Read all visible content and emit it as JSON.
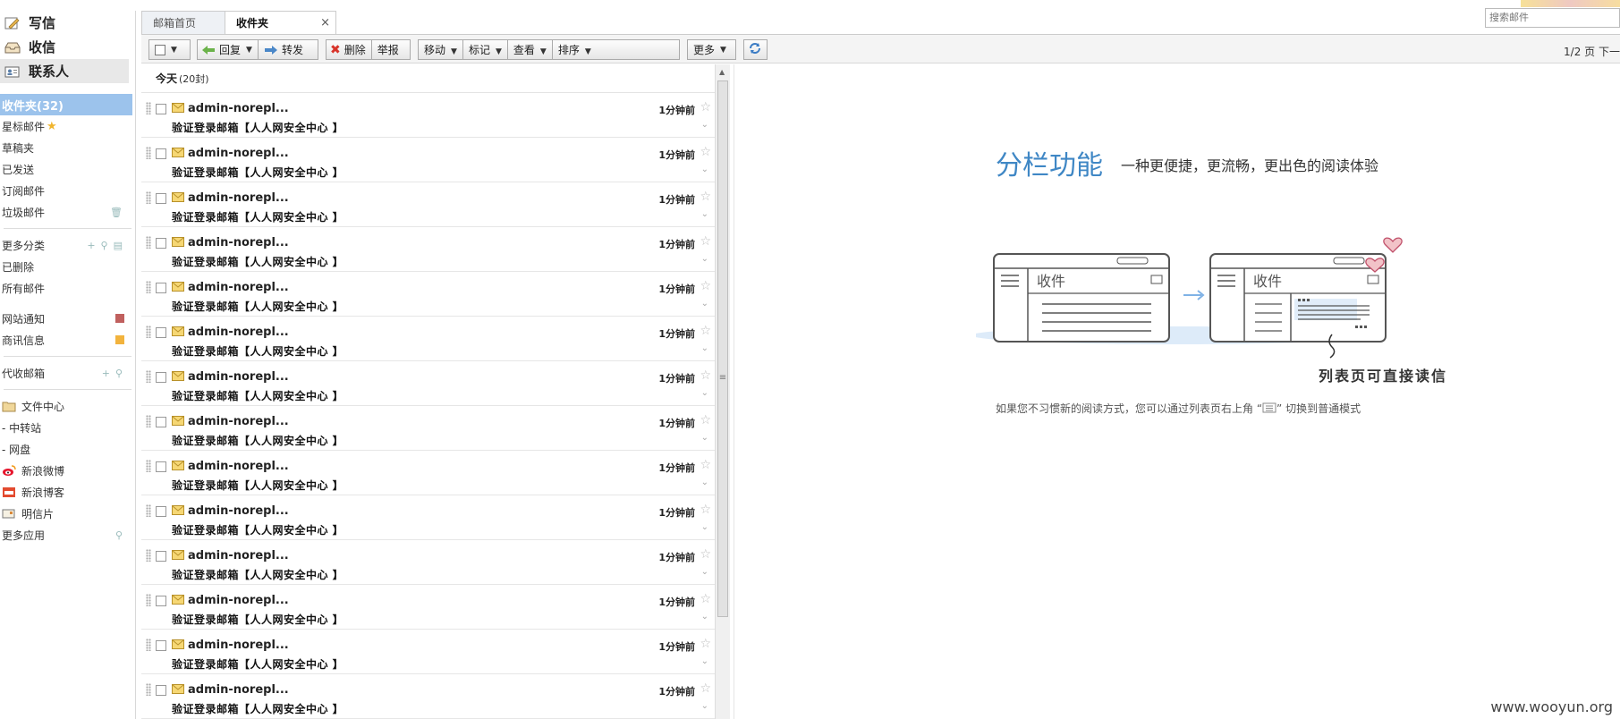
{
  "sidebar": {
    "actions": [
      {
        "label": "写信",
        "icon": "compose-icon"
      },
      {
        "label": "收信",
        "icon": "inbox-tray-icon"
      },
      {
        "label": "联系人",
        "icon": "contacts-card-icon"
      }
    ],
    "folders": [
      {
        "label": "收件夹(32)"
      },
      {
        "label": "星标邮件"
      },
      {
        "label": "草稿夹"
      },
      {
        "label": "已发送"
      },
      {
        "label": "订阅邮件"
      },
      {
        "label": "垃圾邮件"
      }
    ],
    "more_categories": "更多分类",
    "more_items": [
      "已删除",
      "所有邮件"
    ],
    "tag_items": [
      {
        "label": "网站通知",
        "color": "#c0605e"
      },
      {
        "label": "商讯信息",
        "color": "#f2b33d"
      }
    ],
    "proxy_mail": "代收邮箱",
    "apps": [
      {
        "label": "文件中心",
        "icon": "folder-icon"
      },
      {
        "label": "- 中转站"
      },
      {
        "label": "- 网盘"
      },
      {
        "label": "新浪微博",
        "icon": "weibo-icon"
      },
      {
        "label": "新浪博客",
        "icon": "blog-icon"
      },
      {
        "label": "明信片",
        "icon": "postcard-icon"
      }
    ],
    "more_apps": "更多应用"
  },
  "tabs": [
    {
      "label": "邮箱首页"
    },
    {
      "label": "收件夹",
      "close": "×"
    }
  ],
  "search": {
    "placeholder": "搜索邮件"
  },
  "toolbar": {
    "reply": "回复",
    "forward": "转发",
    "delete": "删除",
    "report": "举报",
    "move": "移动",
    "mark": "标记",
    "view": "查看",
    "sort": "排序",
    "more": "更多",
    "pager": "1/2 页  下一"
  },
  "list": {
    "group_title": "今天",
    "group_count": "(20封)",
    "rows": [
      {
        "sender": "admin-norepl...",
        "subject": "验证登录邮箱【人人网安全中心 】",
        "time": "1分钟前"
      },
      {
        "sender": "admin-norepl...",
        "subject": "验证登录邮箱【人人网安全中心 】",
        "time": "1分钟前"
      },
      {
        "sender": "admin-norepl...",
        "subject": "验证登录邮箱【人人网安全中心 】",
        "time": "1分钟前"
      },
      {
        "sender": "admin-norepl...",
        "subject": "验证登录邮箱【人人网安全中心 】",
        "time": "1分钟前"
      },
      {
        "sender": "admin-norepl...",
        "subject": "验证登录邮箱【人人网安全中心 】",
        "time": "1分钟前"
      },
      {
        "sender": "admin-norepl...",
        "subject": "验证登录邮箱【人人网安全中心 】",
        "time": "1分钟前"
      },
      {
        "sender": "admin-norepl...",
        "subject": "验证登录邮箱【人人网安全中心 】",
        "time": "1分钟前"
      },
      {
        "sender": "admin-norepl...",
        "subject": "验证登录邮箱【人人网安全中心 】",
        "time": "1分钟前"
      },
      {
        "sender": "admin-norepl...",
        "subject": "验证登录邮箱【人人网安全中心 】",
        "time": "1分钟前"
      },
      {
        "sender": "admin-norepl...",
        "subject": "验证登录邮箱【人人网安全中心 】",
        "time": "1分钟前"
      },
      {
        "sender": "admin-norepl...",
        "subject": "验证登录邮箱【人人网安全中心 】",
        "time": "1分钟前"
      },
      {
        "sender": "admin-norepl...",
        "subject": "验证登录邮箱【人人网安全中心 】",
        "time": "1分钟前"
      },
      {
        "sender": "admin-norepl...",
        "subject": "验证登录邮箱【人人网安全中心 】",
        "time": "1分钟前"
      },
      {
        "sender": "admin-norepl...",
        "subject": "验证登录邮箱【人人网安全中心 】",
        "time": "1分钟前"
      }
    ]
  },
  "preview": {
    "title": "分栏功能",
    "subtitle": "一种更便捷，更流畅，更出色的阅读体验",
    "illus_label_left": "收件",
    "illus_label_right": "收件",
    "caption": "列表页可直接读信",
    "tip_before": "如果您不习惯新的阅读方式，您可以通过列表页右上角 “",
    "tip_after": "” 切换到普通模式"
  },
  "watermark": "www.wooyun.org",
  "colors": {
    "accent": "#3f87c5",
    "selected_folder": "#9cc3ec"
  }
}
